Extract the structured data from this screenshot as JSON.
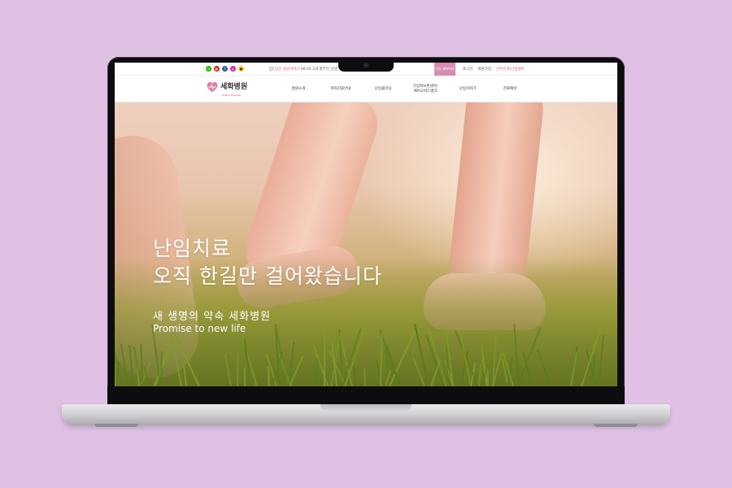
{
  "topbar": {
    "social_icons": [
      "blog-icon",
      "youtube-icon",
      "facebook-icon",
      "instagram-icon",
      "kakao-icon"
    ],
    "notice_tag": "💬 임신 성공이야기",
    "notice_text": "06.05 2과 합부인 선생",
    "cta_label": "진료 예약하기",
    "links": [
      "로그인",
      "회원가입",
      "산부인과/난임센터"
    ]
  },
  "nav": {
    "logo_text": "세화병원",
    "logo_sub": "Sewha Hospital",
    "menu": [
      {
        "label": "병원소개"
      },
      {
        "label": "여자진료안내"
      },
      {
        "label": "난임클리닉"
      },
      {
        "label": "가임력보존센터/\n베이오비드뱅크"
      },
      {
        "label": "난임이야기"
      },
      {
        "label": "진료예약"
      }
    ]
  },
  "hero": {
    "line1": "난임치료",
    "line2": "오직 한길만 걸어왔습니다",
    "sub_ko": "새 생명의 약속 세화병원",
    "sub_en": "Promise to new life"
  },
  "colors": {
    "accent": "#d94f7d",
    "cta_bg": "#d98ab0",
    "page_bg": "#dfc2e3"
  }
}
